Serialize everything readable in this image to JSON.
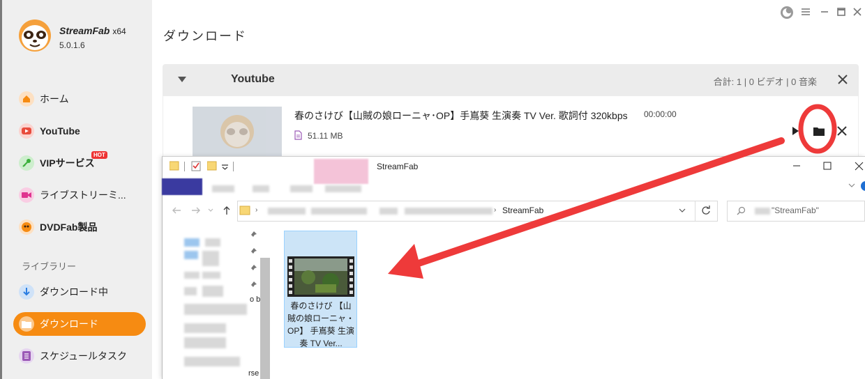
{
  "app": {
    "name": "StreamFab",
    "edition": "x64",
    "version": "5.0.1.6"
  },
  "sidebar": {
    "items": [
      {
        "label": "ホーム",
        "icon": "home-icon",
        "color": "#f68b12"
      },
      {
        "label": "YouTube",
        "icon": "youtube-icon",
        "color": "#e84c3d"
      },
      {
        "label": "VIPサービス",
        "icon": "key-icon",
        "color": "#3aaf3a",
        "badge": "HOT"
      },
      {
        "label": "ライブストリーミ...",
        "icon": "live-camera-icon",
        "color": "#e0338f"
      },
      {
        "label": "DVDFab製品",
        "icon": "dvdfab-icon",
        "color": "#f68b12"
      }
    ],
    "library_label": "ライブラリー",
    "library": [
      {
        "label": "ダウンロード中",
        "icon": "download-arrow-icon",
        "color": "#2a7de1"
      },
      {
        "label": "ダウンロード",
        "icon": "folder-icon",
        "color": "#f68b12",
        "active": true
      },
      {
        "label": "スケジュールタスク",
        "icon": "schedule-icon",
        "color": "#9b59b6"
      }
    ]
  },
  "main": {
    "title": "ダウンロード",
    "panel": {
      "source": "Youtube",
      "summary": "合計: 1 | 0 ビデオ | 0 音楽"
    },
    "item": {
      "title": "春のさけび【山賊の娘ローニャ･OP】手嶌葵 生演奏 TV Ver. 歌詞付 320kbps",
      "duration": "00:00:00",
      "size": "51.11 MB"
    }
  },
  "explorer": {
    "window_title": "StreamFab",
    "path_last": "StreamFab",
    "search_placeholder": "\"StreamFab\"",
    "file_label": "春のさけび 【山賊の娘ローニャ・OP】 手嶌葵 生演奏 TV Ver...",
    "nav_fragments": [
      "o b",
      "rse"
    ]
  },
  "annotation": {
    "color": "#ee3a3a"
  }
}
